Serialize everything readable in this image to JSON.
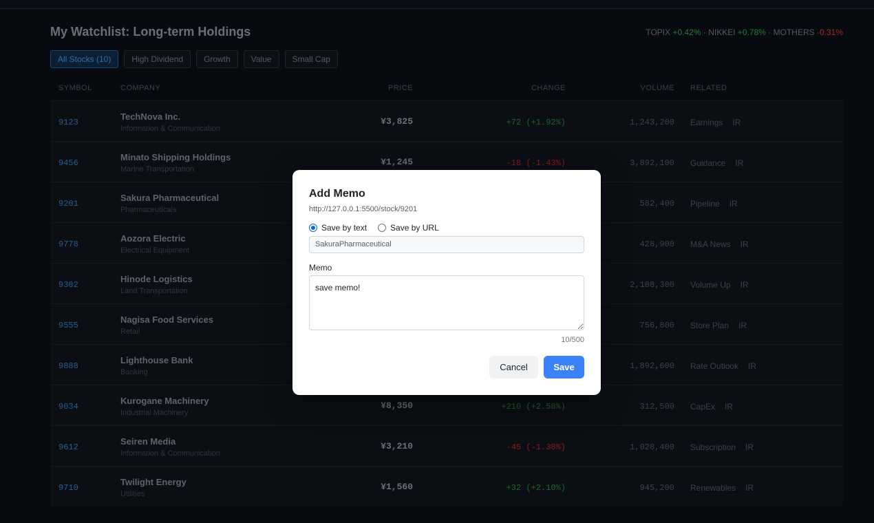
{
  "header": {
    "title": "My Watchlist: Long-term Holdings",
    "indices": [
      {
        "name": "TOPIX",
        "change": "+0.42%",
        "dir": "up"
      },
      {
        "name": "NIKKEI",
        "change": "+0.78%",
        "dir": "up"
      },
      {
        "name": "MOTHERS",
        "change": "-0.31%",
        "dir": "down"
      }
    ],
    "separator": " · "
  },
  "filters": [
    "All Stocks (10)",
    "High Dividend",
    "Growth",
    "Value",
    "Small Cap"
  ],
  "columns": {
    "symbol": "SYMBOL",
    "company": "COMPANY",
    "price": "PRICE",
    "change": "CHANGE",
    "volume": "VOLUME",
    "related": "RELATED"
  },
  "rows": [
    {
      "symbol": "9123",
      "company": "TechNova Inc.",
      "sector": "Information & Communication",
      "price": "¥3,825",
      "change": "+72 (+1.92%)",
      "dir": "up",
      "volume": "1,243,200",
      "related": [
        "Earnings",
        "IR"
      ]
    },
    {
      "symbol": "9456",
      "company": "Minato Shipping Holdings",
      "sector": "Marine Transportation",
      "price": "¥1,245",
      "change": "-18 (-1.43%)",
      "dir": "down",
      "volume": "3,892,100",
      "related": [
        "Guidance",
        "IR"
      ]
    },
    {
      "symbol": "9201",
      "company": "Sakura Pharmaceutical",
      "sector": "Pharmaceuticals",
      "price": "",
      "change": "",
      "dir": "up",
      "volume": "582,400",
      "related": [
        "Pipeline",
        "IR"
      ]
    },
    {
      "symbol": "9778",
      "company": "Aozora Electric",
      "sector": "Electrical Equipment",
      "price": "",
      "change": "",
      "dir": "up",
      "volume": "428,900",
      "related": [
        "M&A News",
        "IR"
      ]
    },
    {
      "symbol": "9302",
      "company": "Hinode Logistics",
      "sector": "Land Transportation",
      "price": "",
      "change": "",
      "dir": "up",
      "volume": "2,108,300",
      "related": [
        "Volume Up",
        "IR"
      ]
    },
    {
      "symbol": "9555",
      "company": "Nagisa Food Services",
      "sector": "Retail",
      "price": "",
      "change": "",
      "dir": "up",
      "volume": "756,800",
      "related": [
        "Store Plan",
        "IR"
      ]
    },
    {
      "symbol": "9888",
      "company": "Lighthouse Bank",
      "sector": "Banking",
      "price": "",
      "change": "",
      "dir": "up",
      "volume": "1,892,600",
      "related": [
        "Rate Outlook",
        "IR"
      ]
    },
    {
      "symbol": "9034",
      "company": "Kurogane Machinery",
      "sector": "Industrial Machinery",
      "price": "¥8,350",
      "change": "+210 (+2.58%)",
      "dir": "up",
      "volume": "312,500",
      "related": [
        "CapEx",
        "IR"
      ]
    },
    {
      "symbol": "9612",
      "company": "Seiren Media",
      "sector": "Information & Communication",
      "price": "¥3,210",
      "change": "-45 (-1.38%)",
      "dir": "down",
      "volume": "1,028,400",
      "related": [
        "Subscription",
        "IR"
      ]
    },
    {
      "symbol": "9710",
      "company": "Twilight Energy",
      "sector": "Utilities",
      "price": "¥1,560",
      "change": "+32 (+2.10%)",
      "dir": "up",
      "volume": "945,200",
      "related": [
        "Renewables",
        "IR"
      ]
    }
  ],
  "modal": {
    "title": "Add Memo",
    "url": "http://127.0.0.1:5500/stock/9201",
    "radio_text": "Save by text",
    "radio_url": "Save by URL",
    "selected": "text",
    "text_value": "SakuraPharmaceutical",
    "memo_label": "Memo",
    "memo_value": "save memo!",
    "counter": "10/500",
    "cancel": "Cancel",
    "save": "Save"
  }
}
